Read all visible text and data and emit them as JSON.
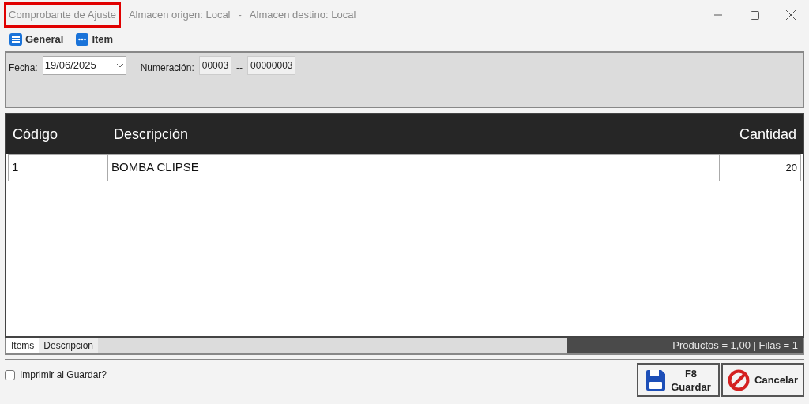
{
  "window": {
    "title_parts": [
      {
        "text": "Comprobante de Ajuste",
        "highlighted": true
      },
      {
        "text": "Almacen origen: Local",
        "highlighted": false
      },
      {
        "text": "-",
        "highlighted": false
      },
      {
        "text": "Almacen destino: Local",
        "highlighted": false
      }
    ]
  },
  "toolbar": [
    {
      "kind": "list",
      "label": "General"
    },
    {
      "kind": "more",
      "label": "Item"
    }
  ],
  "header": {
    "date_label": "Fecha:",
    "date_value": "19/06/2025",
    "number_label": "Numeración:",
    "series": "00003",
    "separator": "--",
    "number": "00000003"
  },
  "table": {
    "columns": [
      "Código",
      "Descripción",
      "Cantidad"
    ],
    "rows": [
      [
        "1",
        "BOMBA CLIPSE",
        "20"
      ]
    ]
  },
  "bottom_tabs": [
    {
      "label": "Items",
      "selected": true
    },
    {
      "label": "Descripcion",
      "selected": false
    }
  ],
  "summary": "Productos = 1,00 | Filas = 1",
  "print_checkbox": {
    "label": "Imprimir al Guardar?",
    "checked": false
  },
  "buttons": [
    {
      "kind": "save",
      "lines": [
        "F8",
        "Guardar"
      ]
    },
    {
      "kind": "cancel",
      "lines": [
        "Cancelar"
      ]
    }
  ]
}
